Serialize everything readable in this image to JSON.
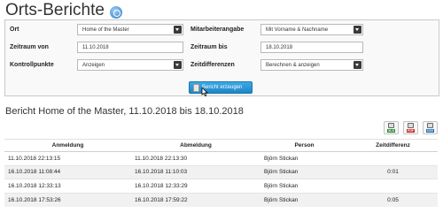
{
  "header": {
    "title": "Orts-Berichte",
    "help_icon": "help-icon"
  },
  "filters": {
    "ort": {
      "label": "Ort",
      "value": "Home of the Master"
    },
    "zeitraum_von": {
      "label": "Zeitraum von",
      "value": "11.10.2018"
    },
    "kontrollpunkte": {
      "label": "Kontrollpunkte",
      "value": "Anzeigen"
    },
    "mitarbeiter": {
      "label": "Mitarbeiterangabe",
      "value": "Mit Vorname & Nachname"
    },
    "zeitraum_bis": {
      "label": "Zeitraum bis",
      "value": "18.10.2018"
    },
    "zeitdifferenzen": {
      "label": "Zeitdifferenzen",
      "value": "Berechnen & anzeigen"
    },
    "button_label": "Bericht erzeugen"
  },
  "report": {
    "heading": "Bericht Home of the Master, 11.10.2018 bis 18.10.2018",
    "export_buttons": [
      {
        "tag": "XLS",
        "color": "#2e8b3a"
      },
      {
        "tag": "PDF",
        "color": "#c62828"
      },
      {
        "tag": "CSV",
        "color": "#1f6fb5"
      }
    ],
    "columns": [
      "Anmeldung",
      "Abmeldung",
      "Person",
      "Zeitdifferenz"
    ],
    "rows": [
      {
        "anmeldung": "11.10.2018 22:13:15",
        "abmeldung": "11.10.2018 22:13:30",
        "person": "Björn Stickan",
        "zeitdifferenz": ""
      },
      {
        "anmeldung": "16.10.2018 11:08:44",
        "abmeldung": "16.10.2018 11:10:03",
        "person": "Björn Stickan",
        "zeitdifferenz": "0:01"
      },
      {
        "anmeldung": "16.10.2018 12:33:13",
        "abmeldung": "16.10.2018 12:33:29",
        "person": "Björn Stickan",
        "zeitdifferenz": ""
      },
      {
        "anmeldung": "16.10.2018 17:53:26",
        "abmeldung": "16.10.2018 17:59:22",
        "person": "Björn Stickan",
        "zeitdifferenz": "0:05"
      }
    ]
  }
}
